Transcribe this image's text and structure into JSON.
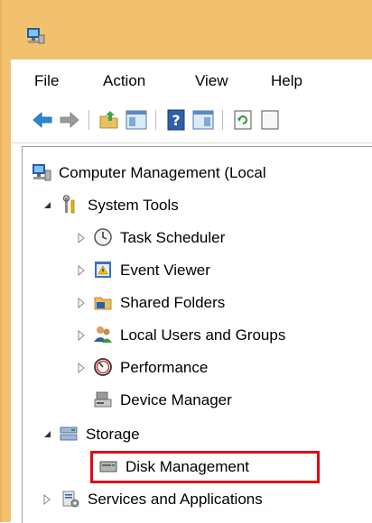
{
  "menu": {
    "file": "File",
    "action": "Action",
    "view": "View",
    "help": "Help"
  },
  "tree": {
    "root": "Computer Management (Local",
    "system_tools": "System Tools",
    "task_scheduler": "Task Scheduler",
    "event_viewer": "Event Viewer",
    "shared_folders": "Shared Folders",
    "local_users": "Local Users and Groups",
    "performance": "Performance",
    "device_manager": "Device Manager",
    "storage": "Storage",
    "disk_management": "Disk Management",
    "services": "Services and Applications"
  },
  "colors": {
    "title_bar": "#f1c16e",
    "highlight_border": "#e30613",
    "back_arrow": "#2b88d8"
  }
}
